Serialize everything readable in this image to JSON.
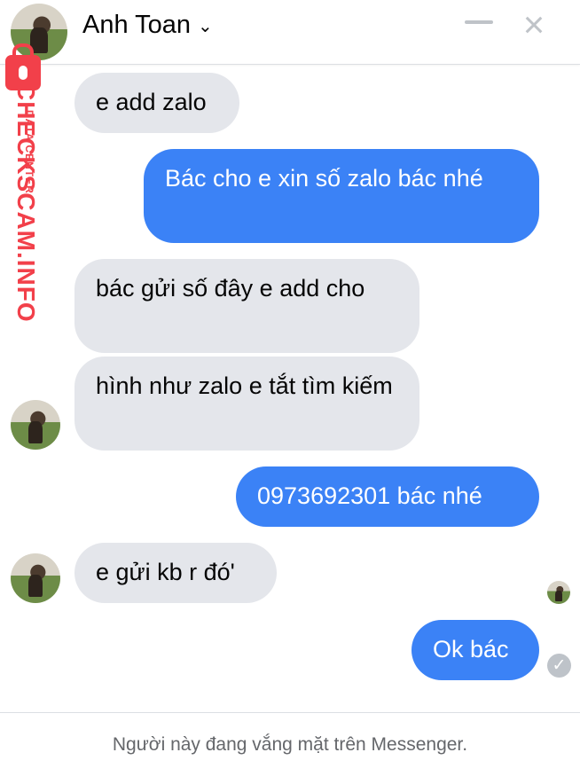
{
  "header": {
    "contact_name": "Anh Toan",
    "chevron_icon": "chevron-down-icon",
    "minimize_icon": "minimize-icon",
    "close_icon": "close-icon"
  },
  "messages": [
    {
      "direction": "incoming",
      "text": "e add zalo"
    },
    {
      "direction": "outgoing",
      "text": "Bác cho e xin số zalo bác nhé"
    },
    {
      "direction": "incoming",
      "text": "bác gửi số đây e add cho"
    },
    {
      "direction": "incoming",
      "text": "hình như zalo e tắt tìm kiếm"
    },
    {
      "direction": "outgoing",
      "text": "0973692301 bác nhé"
    },
    {
      "direction": "incoming",
      "text": "e gửi kb r đó'"
    },
    {
      "direction": "outgoing",
      "text": "Ok bác"
    }
  ],
  "footer": {
    "status_text": "Người này đang vắng mặt trên Messenger."
  },
  "watermark": {
    "line1": "CHECKSCAM.INFO",
    "line2": "DATA CENTER"
  },
  "icons": {
    "read_receipt": "check-circle-icon",
    "lock": "lock-icon"
  }
}
